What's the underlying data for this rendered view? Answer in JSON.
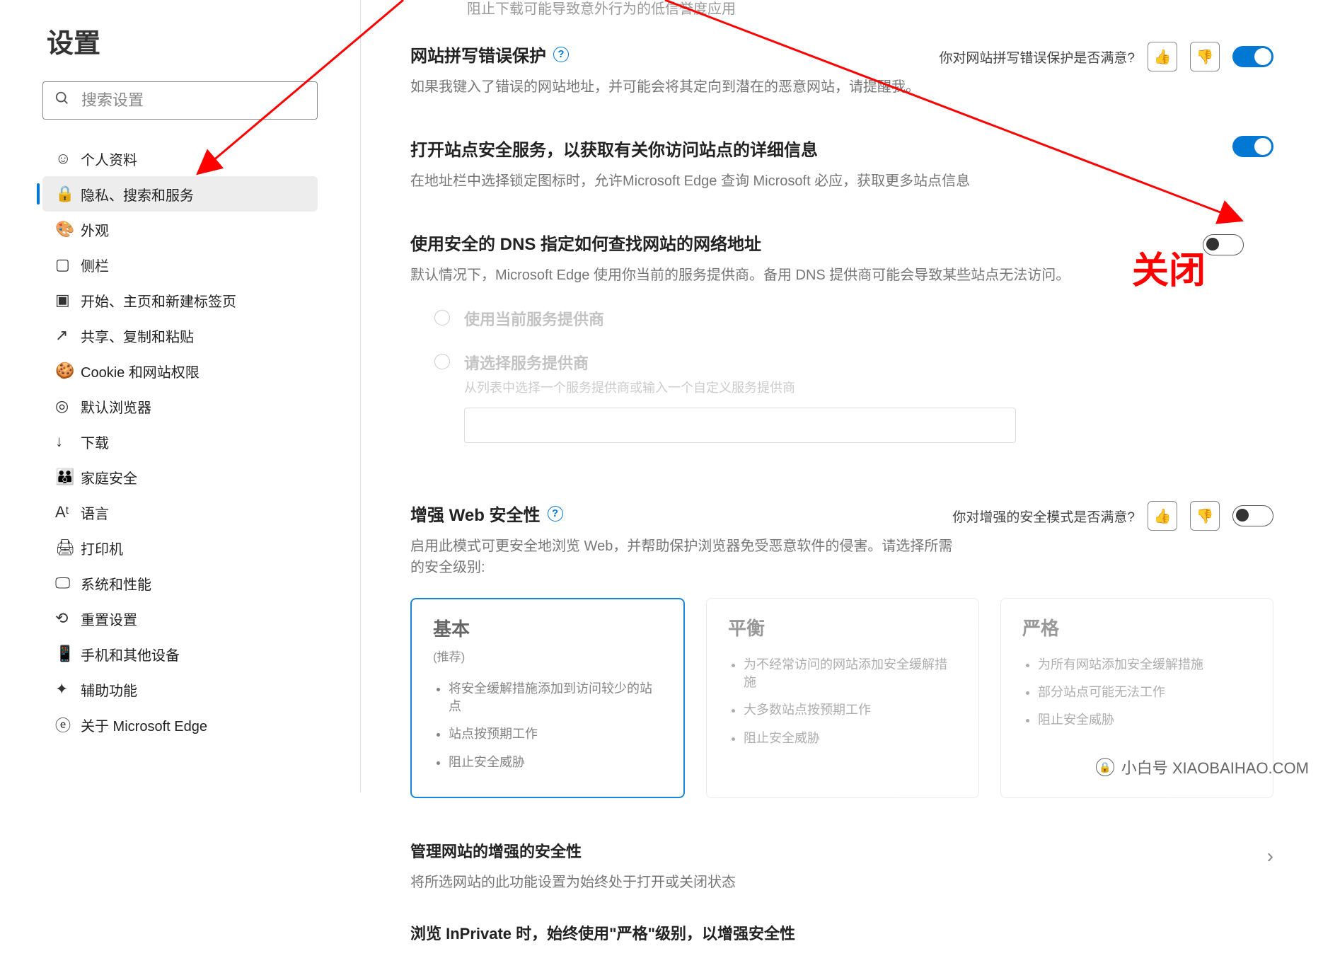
{
  "sidebar": {
    "title": "设置",
    "search_placeholder": "搜索设置",
    "items": [
      {
        "label": "个人资料",
        "active": false
      },
      {
        "label": "隐私、搜索和服务",
        "active": true
      },
      {
        "label": "外观",
        "active": false
      },
      {
        "label": "侧栏",
        "active": false
      },
      {
        "label": "开始、主页和新建标签页",
        "active": false
      },
      {
        "label": "共享、复制和粘贴",
        "active": false
      },
      {
        "label": "Cookie 和网站权限",
        "active": false
      },
      {
        "label": "默认浏览器",
        "active": false
      },
      {
        "label": "下载",
        "active": false
      },
      {
        "label": "家庭安全",
        "active": false
      },
      {
        "label": "语言",
        "active": false
      },
      {
        "label": "打印机",
        "active": false
      },
      {
        "label": "系统和性能",
        "active": false
      },
      {
        "label": "重置设置",
        "active": false
      },
      {
        "label": "手机和其他设备",
        "active": false
      },
      {
        "label": "辅助功能",
        "active": false
      },
      {
        "label": "关于 Microsoft Edge",
        "active": false
      }
    ]
  },
  "settings": {
    "block_low_rep_desc": "阻止下载可能导致意外行为的低信誉度应用",
    "typo": {
      "title": "网站拼写错误保护",
      "feedback_q": "你对网站拼写错误保护是否满意?",
      "desc": "如果我键入了错误的网站地址，并可能会将其定向到潜在的恶意网站，请提醒我。",
      "on": true
    },
    "site_safety": {
      "title": "打开站点安全服务，以获取有关你访问站点的详细信息",
      "desc": "在地址栏中选择锁定图标时，允许Microsoft Edge 查询 Microsoft 必应，获取更多站点信息",
      "on": true
    },
    "secure_dns": {
      "title": "使用安全的 DNS 指定如何查找网站的网络地址",
      "desc": "默认情况下，Microsoft Edge 使用你当前的服务提供商。备用 DNS 提供商可能会导致某些站点无法访问。",
      "on": false,
      "opt_current": "使用当前服务提供商",
      "opt_choose": "请选择服务提供商",
      "opt_choose_desc": "从列表中选择一个服务提供商或输入一个自定义服务提供商"
    },
    "enhanced": {
      "title": "增强 Web 安全性",
      "feedback_q": "你对增强的安全模式是否满意?",
      "desc": "启用此模式可更安全地浏览 Web，并帮助保护浏览器免受恶意软件的侵害。请选择所需的安全级别:",
      "on": false,
      "cards": [
        {
          "title": "基本",
          "sub": "(推荐)",
          "bullets": [
            "将安全缓解措施添加到访问较少的站点",
            "站点按预期工作",
            "阻止安全威胁"
          ]
        },
        {
          "title": "平衡",
          "sub": "",
          "bullets": [
            "为不经常访问的网站添加安全缓解措施",
            "大多数站点按预期工作",
            "阻止安全威胁"
          ]
        },
        {
          "title": "严格",
          "sub": "",
          "bullets": [
            "为所有网站添加安全缓解措施",
            "部分站点可能无法工作",
            "阻止安全威胁"
          ]
        }
      ],
      "manage_title": "管理网站的增强的安全性",
      "manage_desc": "将所选网站的此功能设置为始终处于打开或关闭状态",
      "inprivate": "浏览 InPrivate 时，始终使用\"严格\"级别，以增强安全性"
    }
  },
  "annotations": {
    "close_label": "关闭"
  },
  "watermark": {
    "text": "小白号 XIAOBAIHAO.COM"
  }
}
